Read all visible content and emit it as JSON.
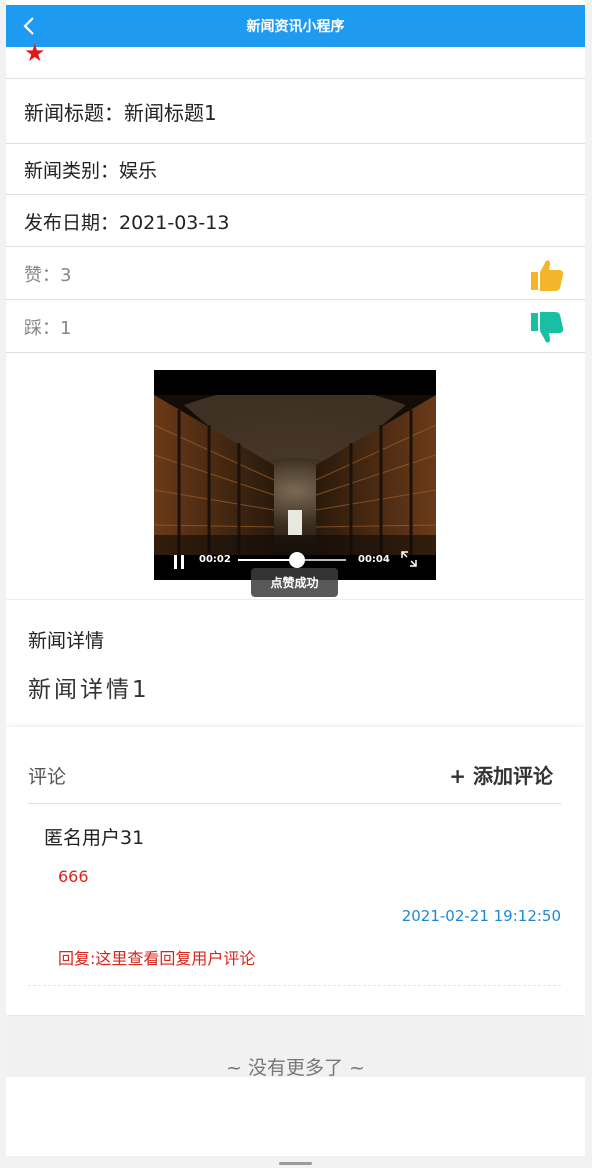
{
  "nav": {
    "title": "新闻资讯小程序"
  },
  "news": {
    "title_text": "新闻标题：新闻标题1",
    "category_text": "新闻类别：娱乐",
    "date_text": "发布日期：2021-03-13",
    "likes_text": "赞：3",
    "dislikes_text": "踩：1"
  },
  "video": {
    "current_time": "00:02",
    "duration": "00:04",
    "progress_fraction": 0.55
  },
  "toast": {
    "text": "点赞成功"
  },
  "detail": {
    "heading": "新闻详情",
    "body": "新闻详情1"
  },
  "comments": {
    "heading": "评论",
    "add_label": "+ 添加评论",
    "items": [
      {
        "user": "匿名用户31",
        "text": "666",
        "time": "2021-02-21 19:12:50",
        "reply": "回复:这里查看回复用户评论"
      }
    ]
  },
  "footer": {
    "no_more": "~ 没有更多了 ~"
  },
  "colors": {
    "nav_bg": "#1e9af0",
    "star": "#e21818",
    "like_icon": "#f5b52a",
    "dislike_icon": "#18bfa2",
    "comment_text": "#d9261c",
    "timestamp": "#1e88d8"
  }
}
